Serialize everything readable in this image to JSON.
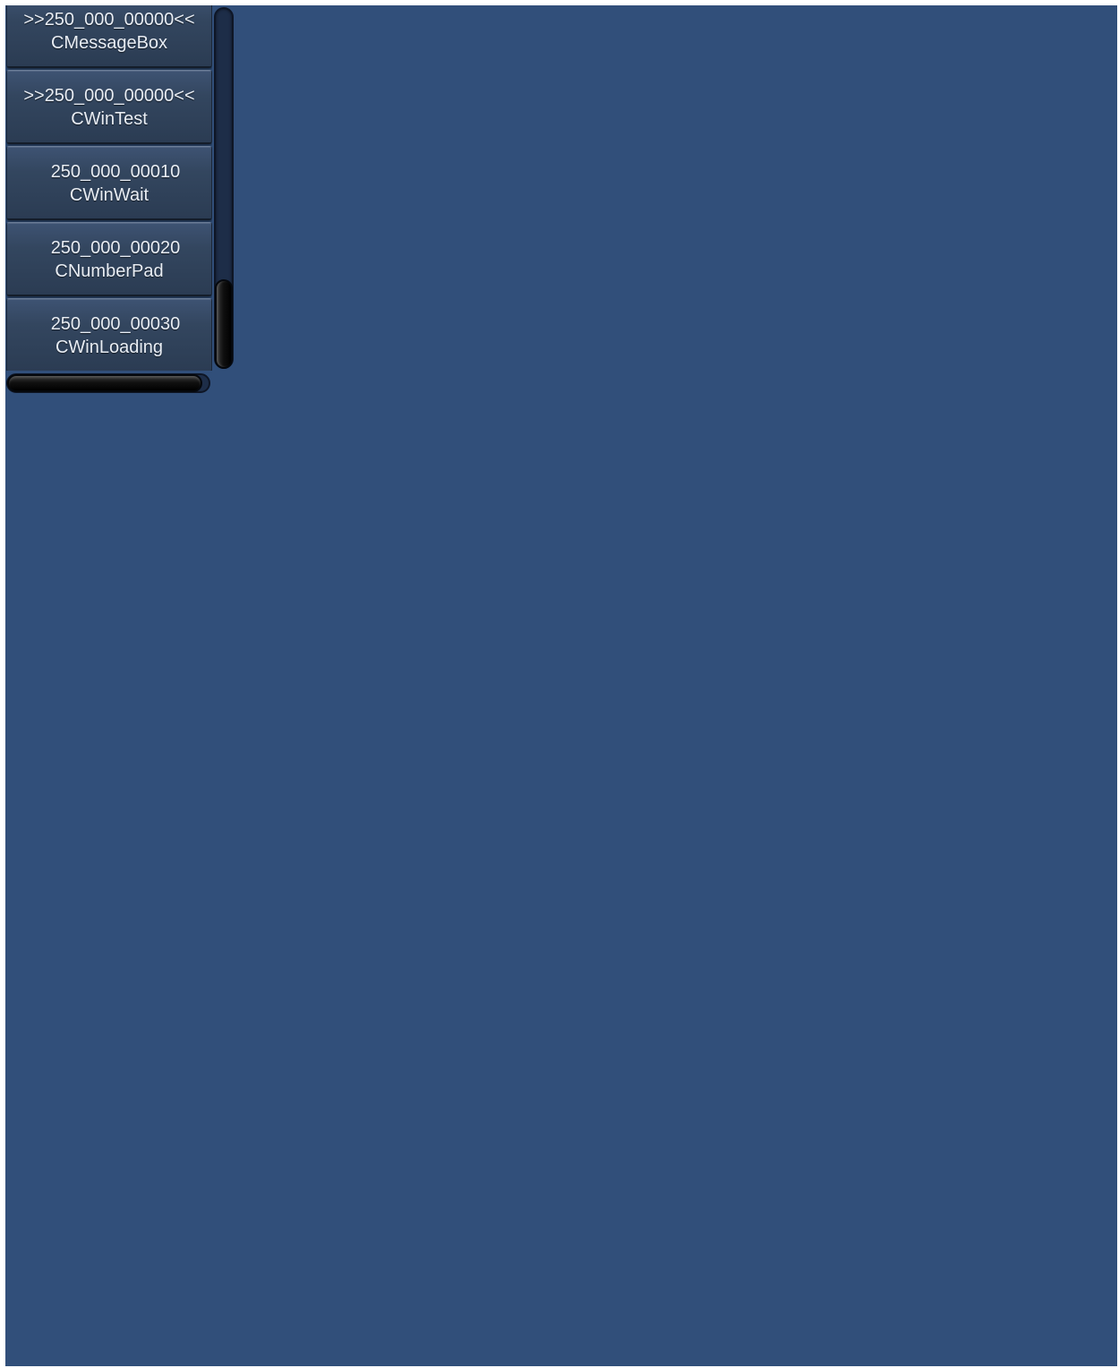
{
  "list": {
    "items": [
      {
        "id": ">>250_000_00000<<",
        "name": "CMessageBox",
        "selected": true
      },
      {
        "id": ">>250_000_00000<<",
        "name": "CWinTest",
        "selected": true
      },
      {
        "id": "250_000_00010",
        "name": "CWinWait",
        "selected": false
      },
      {
        "id": "250_000_00020",
        "name": "CNumberPad",
        "selected": false
      },
      {
        "id": "250_000_00030",
        "name": "CWinLoading",
        "selected": false
      }
    ]
  },
  "colors": {
    "background": "#314f7a",
    "item_text": "#e8edf4",
    "scroll_thumb": "#000000"
  }
}
